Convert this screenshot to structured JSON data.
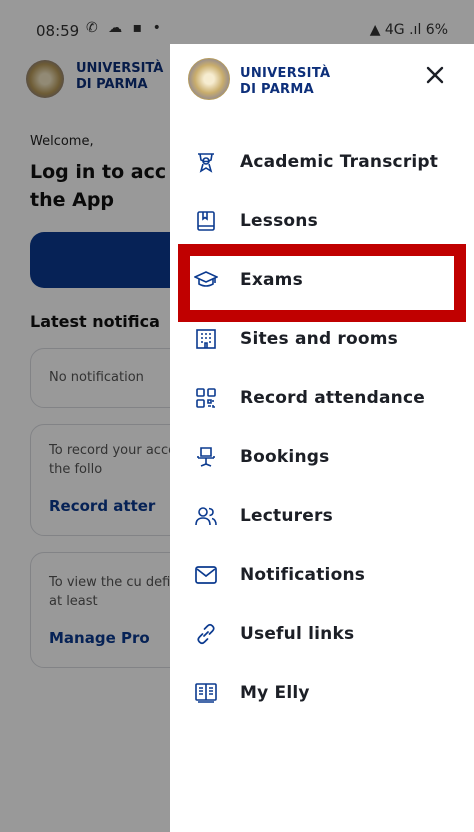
{
  "status_bar": {
    "time": "08:59",
    "left_icons": "✆ ☁ ▪ •",
    "right_icons": "▲ 4G .ıl 6%"
  },
  "background": {
    "brand_line1": "UNIVERSITÀ",
    "brand_line2": "DI PARMA",
    "welcome": "Welcome,",
    "title": "Log in to acc the App",
    "latest": "Latest notifica",
    "card1_text": "No notification",
    "card2_text": "To record your access the follo",
    "card2_link": "Record atter",
    "card3_text": "To view the cu define at least",
    "card3_link": "Manage Pro"
  },
  "drawer": {
    "brand_line1": "UNIVERSITÀ",
    "brand_line2": "DI PARMA",
    "close_label": "×",
    "items": [
      {
        "label": "Academic Transcript",
        "icon": "award-icon"
      },
      {
        "label": "Lessons",
        "icon": "book-icon"
      },
      {
        "label": "Exams",
        "icon": "graduation-cap-icon"
      },
      {
        "label": "Sites and rooms",
        "icon": "building-icon"
      },
      {
        "label": "Record attendance",
        "icon": "qr-code-icon"
      },
      {
        "label": "Bookings",
        "icon": "chair-icon"
      },
      {
        "label": "Lecturers",
        "icon": "users-icon"
      },
      {
        "label": "Notifications",
        "icon": "envelope-icon"
      },
      {
        "label": "Useful links",
        "icon": "link-icon"
      },
      {
        "label": "My Elly",
        "icon": "open-book-icon"
      }
    ]
  },
  "colors": {
    "brand_blue": "#0d2f7a",
    "button_blue": "#0b3a8f",
    "highlight_red": "#c00000",
    "icon_blue": "#0b3a8f"
  }
}
